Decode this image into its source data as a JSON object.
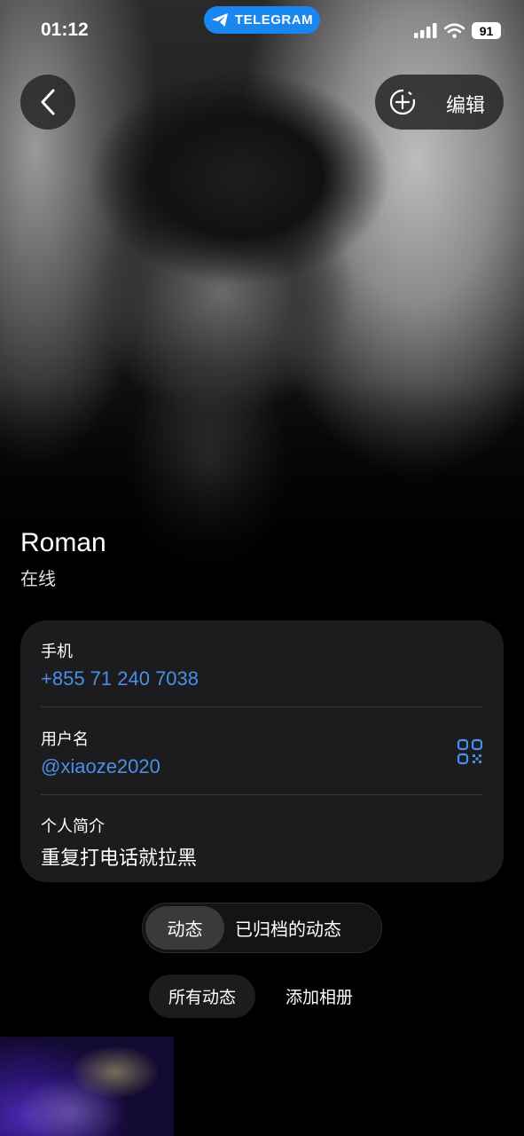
{
  "status_bar": {
    "time": "01:12",
    "app_pill": "TELEGRAM",
    "battery": "91"
  },
  "header": {
    "edit_label": "编辑"
  },
  "profile": {
    "name": "Roman",
    "presence": "在线"
  },
  "info": {
    "phone_label": "手机",
    "phone_value": "+855 71 240 7038",
    "username_label": "用户名",
    "username_value": "@xiaoze2020",
    "bio_label": "个人简介",
    "bio_value": "重复打电话就拉黑"
  },
  "tabs": {
    "active": "动态",
    "archived": "已归档的动态"
  },
  "filters": {
    "all": "所有动态",
    "add_album": "添加相册"
  },
  "colors": {
    "accent": "#4a8fe7",
    "pill": "#1a86f0",
    "card": "#1c1c1e"
  }
}
